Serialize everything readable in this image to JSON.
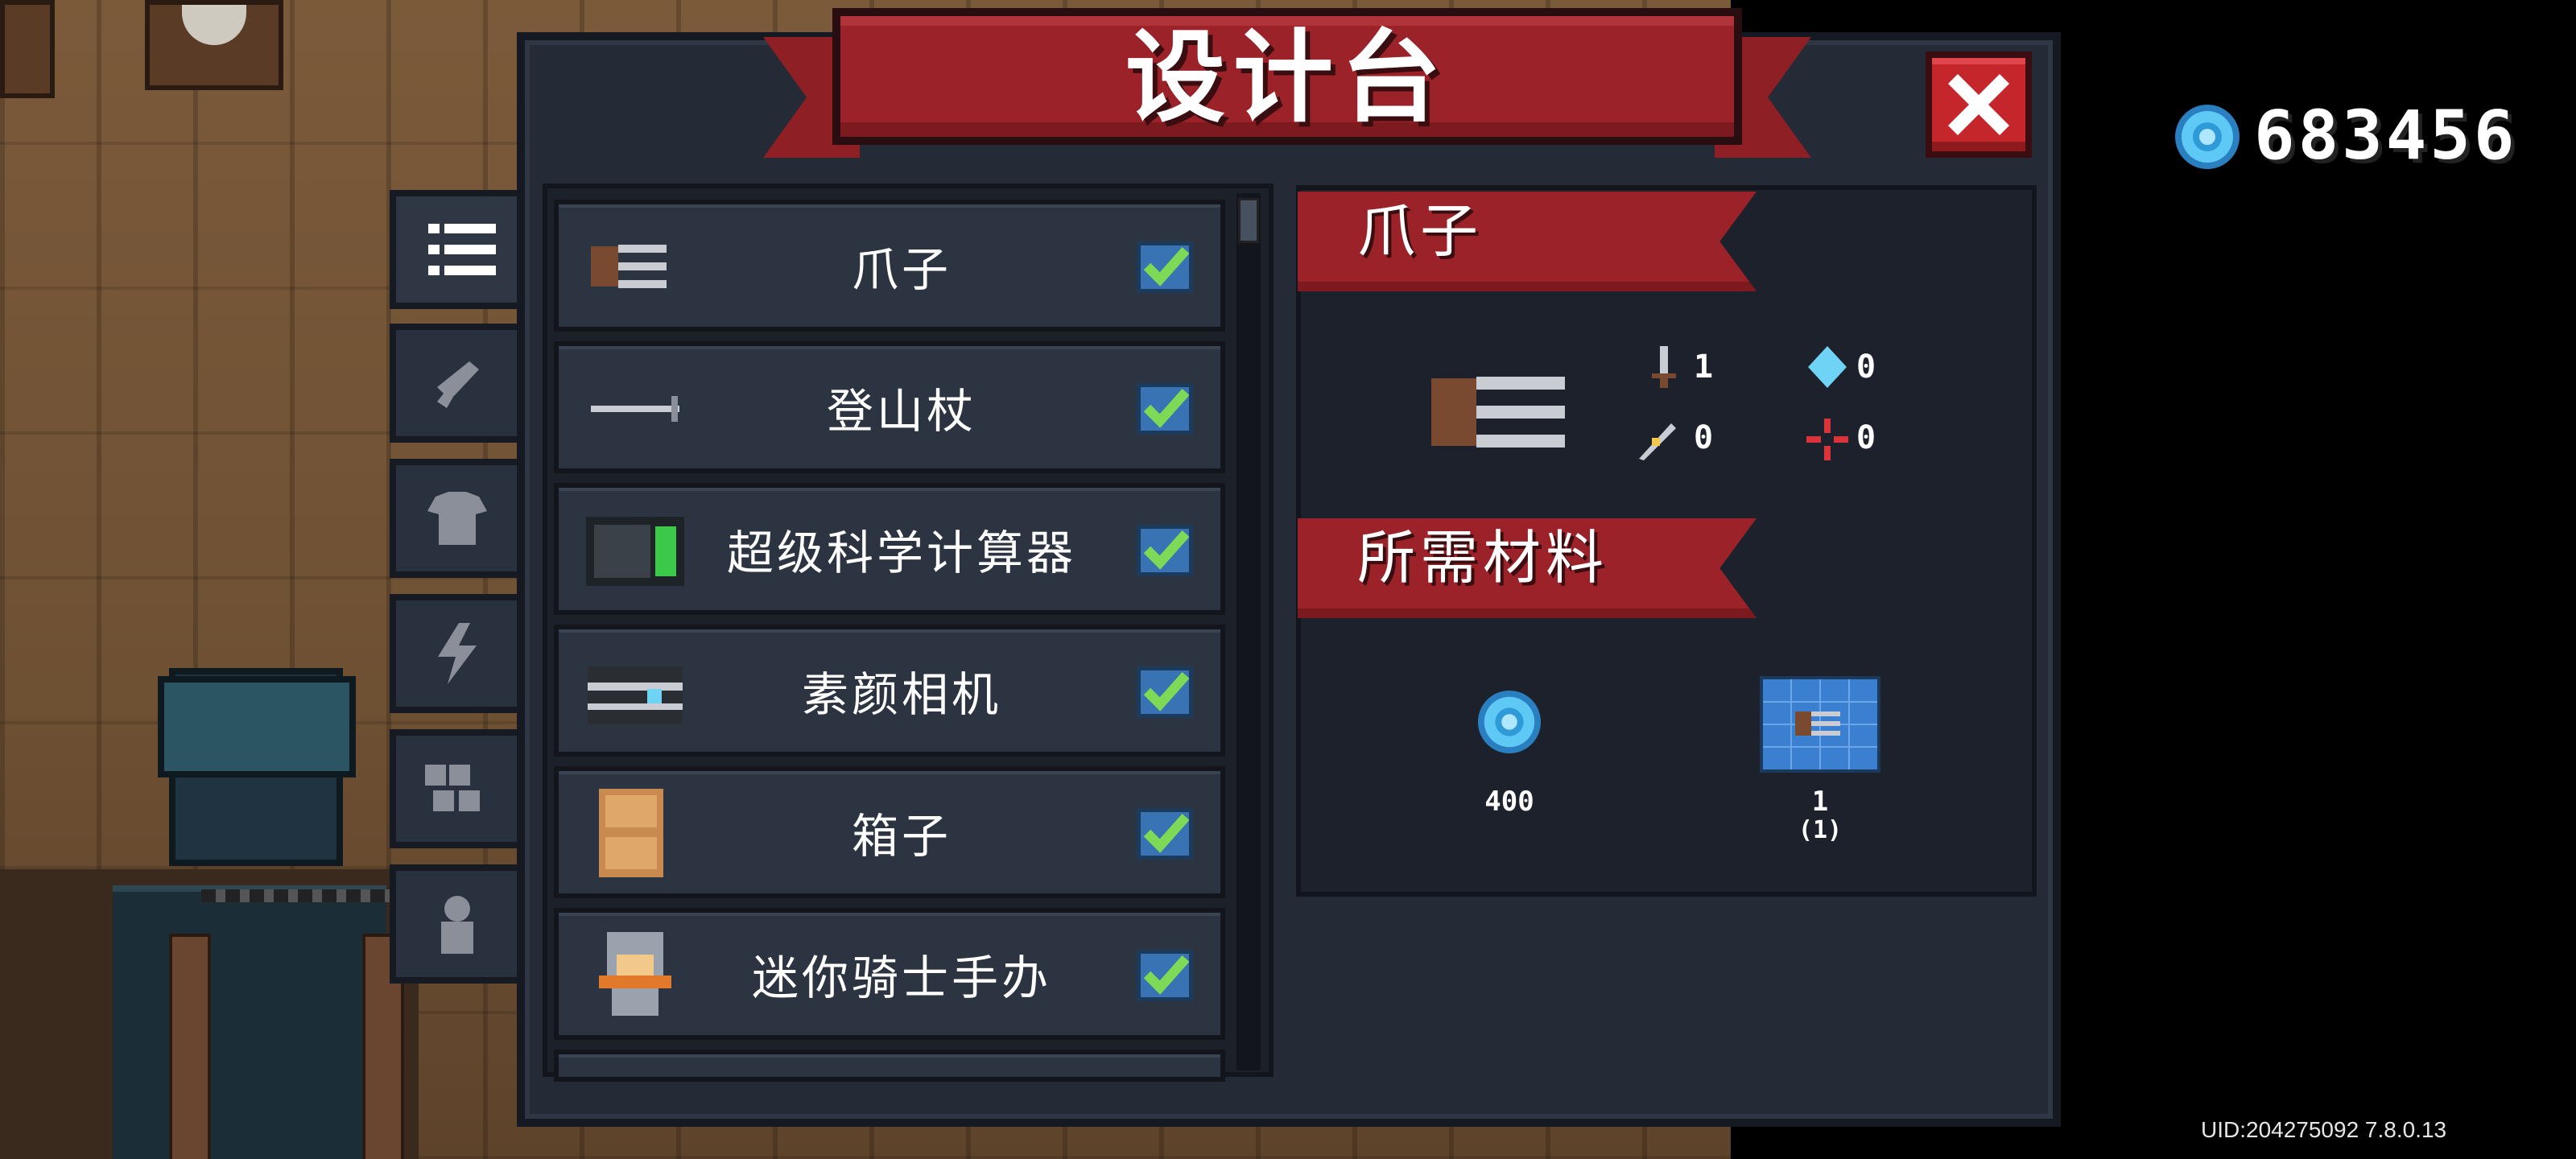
{
  "header": {
    "title": "设计台",
    "currency_amount": "683456"
  },
  "tabs": [
    {
      "icon": "list-icon",
      "active": true
    },
    {
      "icon": "weapon-icon",
      "active": false
    },
    {
      "icon": "armor-icon",
      "active": false
    },
    {
      "icon": "lightning-icon",
      "active": false
    },
    {
      "icon": "blocks-icon",
      "active": false
    },
    {
      "icon": "statue-icon",
      "active": false
    }
  ],
  "items": [
    {
      "name": "爪子",
      "icon": "claw-icon",
      "checked": true
    },
    {
      "name": "登山杖",
      "icon": "hiking-pole-icon",
      "checked": true
    },
    {
      "name": "超级科学计算器",
      "icon": "calculator-icon",
      "checked": true
    },
    {
      "name": "素颜相机",
      "icon": "camera-icon",
      "checked": true
    },
    {
      "name": "箱子",
      "icon": "crate-icon",
      "checked": true
    },
    {
      "name": "迷你骑士手办",
      "icon": "knight-figure-icon",
      "checked": true
    }
  ],
  "detail": {
    "item_name": "爪子",
    "stats": {
      "attack": "1",
      "energy": "0",
      "crit": "0",
      "accuracy": "0"
    },
    "materials_title": "所需材料",
    "materials": [
      {
        "icon": "gem-icon",
        "amount": "400",
        "sub": ""
      },
      {
        "icon": "blueprint-icon",
        "amount": "1",
        "sub": "(1)"
      }
    ]
  },
  "footer": {
    "uid_text": "UID:204275092 7.8.0.13"
  },
  "colors": {
    "ribbon_red": "#9b2228",
    "panel_bg": "#242a36",
    "row_bg": "#2c3441",
    "check_blue": "#3a73b3",
    "check_green": "#7ed957",
    "gem_blue": "#5fc9f5"
  }
}
